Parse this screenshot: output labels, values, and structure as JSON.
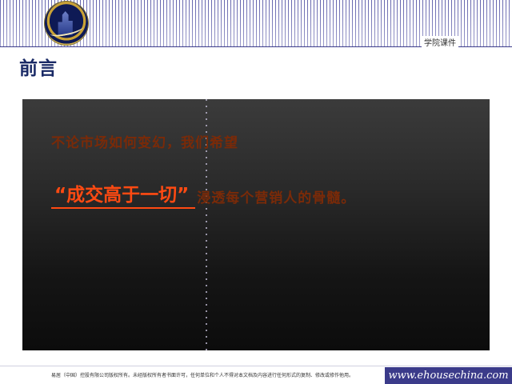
{
  "header": {
    "label": "学院课件"
  },
  "page_title": "前言",
  "slide": {
    "line1": "不论市场如何变幻，我们希望",
    "slogan": "“成交高于一切”",
    "tail": "浸透每个营销人的骨髓。"
  },
  "footer": {
    "text": "易居（中国）控股有限公司版权所有。未经版权所有者书面许可，任何单位和个人不得对本文档及内容进行任何形式的复制、修改或修作他用。",
    "brand": "www.ehousechina.com"
  },
  "colors": {
    "accent": "#ff4a12",
    "text_dim": "#7a2a08",
    "title": "#1a2a66",
    "brand_bg": "#3b3b8a"
  }
}
